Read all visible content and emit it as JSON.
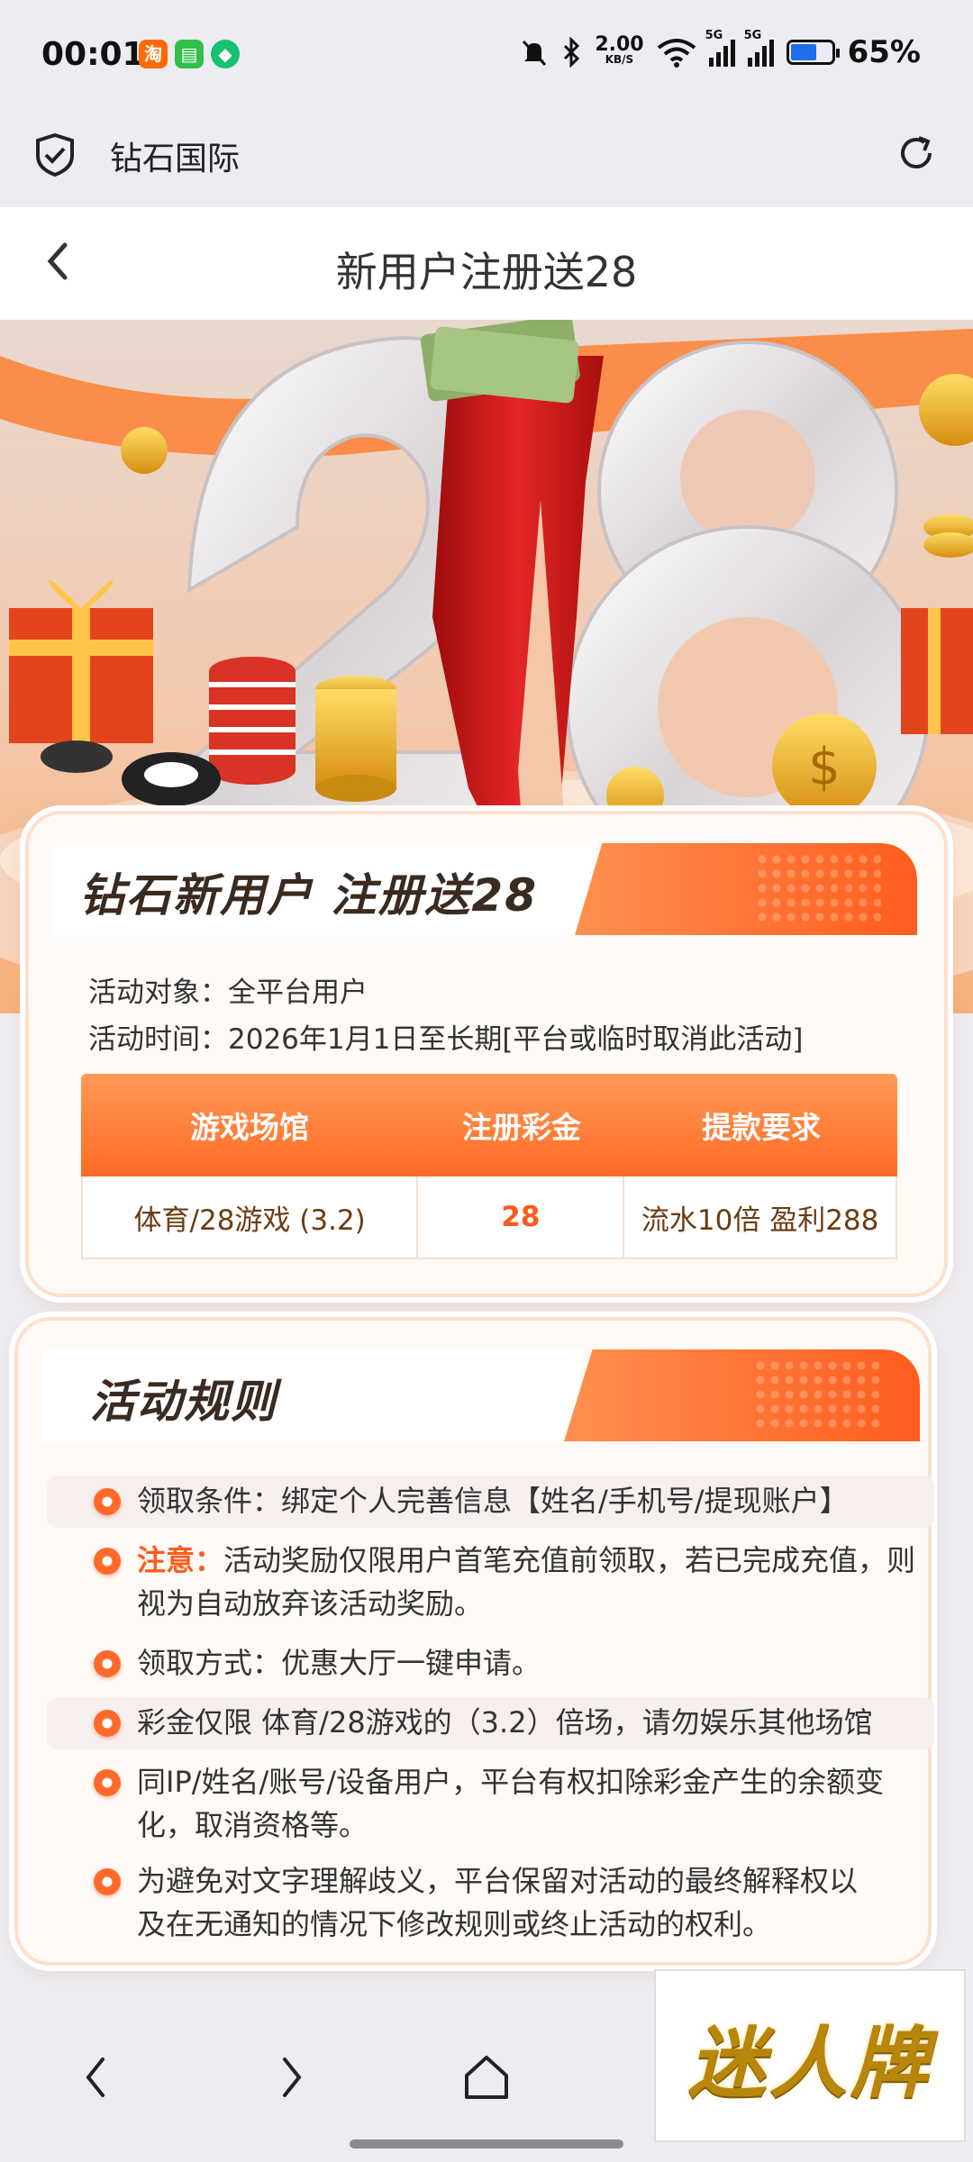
{
  "status_bar": {
    "time": "00:01",
    "net_speed_value": "2.00",
    "net_speed_unit": "KB/S",
    "signal_1_label": "5G",
    "signal_2_label": "5G",
    "battery_percent": "65%",
    "battery_level": 0.65
  },
  "browser": {
    "site_title": "钻石国际"
  },
  "header": {
    "title": "新用户注册送28"
  },
  "promo": {
    "heading": "钻石新用户 注册送28",
    "target_label": "活动对象：",
    "target_value": "全平台用户",
    "time_label": "活动时间：",
    "time_value": "2026年1月1日至长期[平台或临时取消此活动]",
    "table": {
      "headers": [
        "游戏场馆",
        "注册彩金",
        "提款要求"
      ],
      "rows": [
        [
          "体育/28游戏 (3.2)",
          "28",
          "流水10倍 盈利288"
        ]
      ]
    }
  },
  "rules": {
    "heading": "活动规则",
    "items": [
      {
        "text": "领取条件：绑定个人完善信息【姓名/手机号/提现账户】"
      },
      {
        "note": "注意：",
        "text": "活动奖励仅限用户首笔充值前领取，若已完成充值，则视为自动放弃该活动奖励。"
      },
      {
        "text": "领取方式：优惠大厅一键申请。"
      },
      {
        "text": "彩金仅限 体育/28游戏的（3.2）倍场，请勿娱乐其他场馆"
      },
      {
        "text": "同IP/姓名/账号/设备用户，平台有权扣除彩金产生的余额变化，取消资格等。"
      },
      {
        "text": "为避免对文字理解歧义，平台保留对活动的最终解释权以及在无通知的情况下修改规则或终止活动的权利。"
      }
    ]
  },
  "watermark": {
    "text": "迷人牌"
  },
  "colors": {
    "accent": "#ff6a25",
    "accent_light": "#ff9a55",
    "hero_dress": "#d21f1f",
    "background": "#ededf3"
  }
}
